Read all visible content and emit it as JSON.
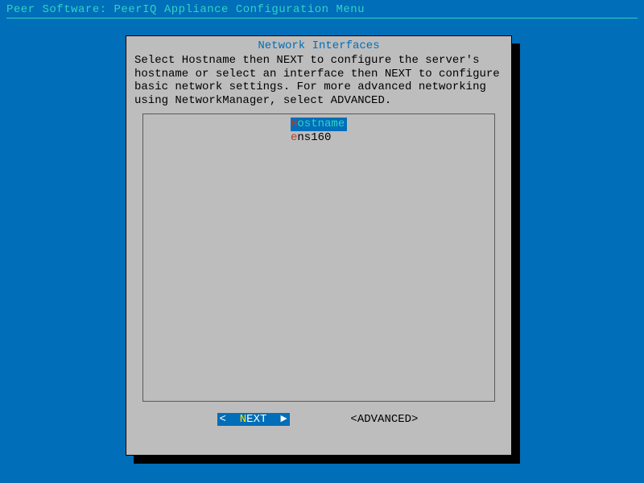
{
  "header": "Peer Software: PeerIQ Appliance Configuration Menu",
  "dialog": {
    "title": "Network Interfaces",
    "text": "Select Hostname then NEXT to configure the server's hostname or select an interface then NEXT to configure basic network settings. For more advanced networking using NetworkManager, select ADVANCED."
  },
  "list": {
    "items": [
      {
        "hot": "H",
        "rest": "ostname",
        "selected": true
      },
      {
        "hot": "e",
        "rest": "ns160",
        "selected": false
      }
    ]
  },
  "buttons": {
    "next": {
      "open": "<",
      "hot": "N",
      "rest": "EXT",
      "close": ">",
      "arrow": "►",
      "primary": true
    },
    "advanced": {
      "open": "<",
      "hot": "A",
      "rest": "DVANCED",
      "close": ">",
      "primary": false
    }
  }
}
